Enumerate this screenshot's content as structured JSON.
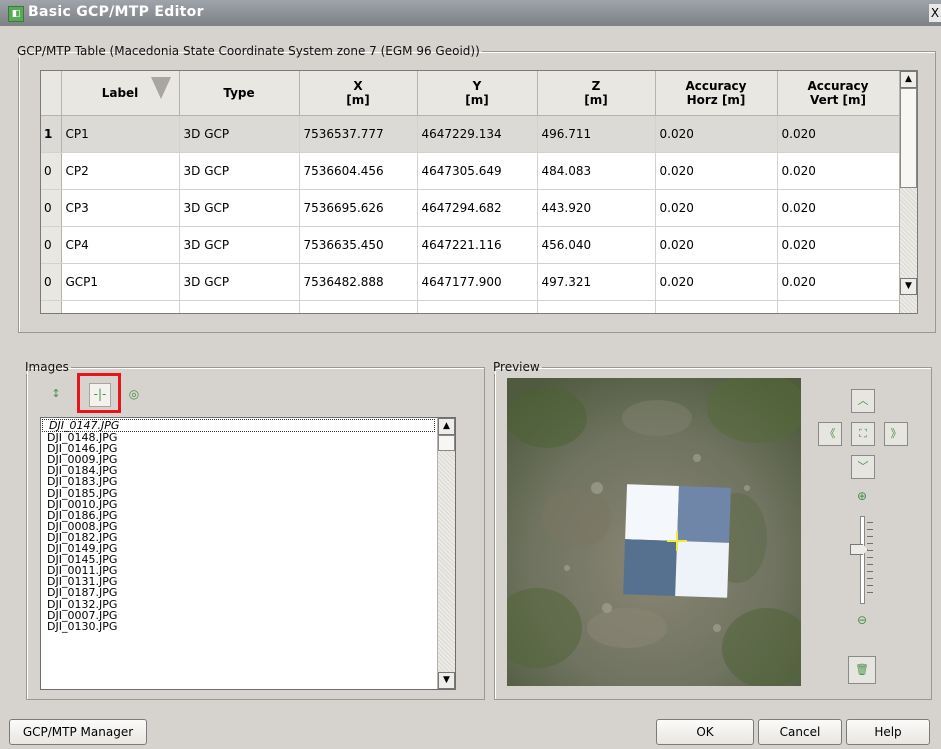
{
  "window": {
    "title": "Basic GCP/MTP Editor",
    "close_glyph": "X",
    "app_icon": "app-icon"
  },
  "table_group": {
    "legend": "GCP/MTP Table (Macedonia State Coordinate System zone 7 (EGM 96 Geoid))"
  },
  "table": {
    "headers": [
      {
        "line1": "Label",
        "line2": ""
      },
      {
        "line1": "Type",
        "line2": ""
      },
      {
        "line1": "X",
        "line2": "[m]"
      },
      {
        "line1": "Y",
        "line2": "[m]"
      },
      {
        "line1": "Z",
        "line2": "[m]"
      },
      {
        "line1": "Accuracy",
        "line2": "Horz [m]"
      },
      {
        "line1": "Accuracy",
        "line2": "Vert [m]"
      }
    ],
    "rows": [
      {
        "flag": "1",
        "label": "CP1",
        "type": "3D GCP",
        "x": "7536537.777",
        "y": "4647229.134",
        "z": "496.711",
        "acc_h": "0.020",
        "acc_v": "0.020"
      },
      {
        "flag": "0",
        "label": "CP2",
        "type": "3D GCP",
        "x": "7536604.456",
        "y": "4647305.649",
        "z": "484.083",
        "acc_h": "0.020",
        "acc_v": "0.020"
      },
      {
        "flag": "0",
        "label": "CP3",
        "type": "3D GCP",
        "x": "7536695.626",
        "y": "4647294.682",
        "z": "443.920",
        "acc_h": "0.020",
        "acc_v": "0.020"
      },
      {
        "flag": "0",
        "label": "CP4",
        "type": "3D GCP",
        "x": "7536635.450",
        "y": "4647221.116",
        "z": "456.040",
        "acc_h": "0.020",
        "acc_v": "0.020"
      },
      {
        "flag": "0",
        "label": "GCP1",
        "type": "3D GCP",
        "x": "7536482.888",
        "y": "4647177.900",
        "z": "497.321",
        "acc_h": "0.020",
        "acc_v": "0.020"
      }
    ]
  },
  "images_group": {
    "legend": "Images",
    "tools": [
      "sort-az-icon",
      "tie-point-icon",
      "camera-icon"
    ],
    "files": [
      "DJI_0147.JPG",
      "DJI_0148.JPG",
      "DJI_0146.JPG",
      "DJI_0009.JPG",
      "DJI_0184.JPG",
      "DJI_0183.JPG",
      "DJI_0185.JPG",
      "DJI_0010.JPG",
      "DJI_0186.JPG",
      "DJI_0008.JPG",
      "DJI_0182.JPG",
      "DJI_0149.JPG",
      "DJI_0145.JPG",
      "DJI_0011.JPG",
      "DJI_0131.JPG",
      "DJI_0187.JPG",
      "DJI_0132.JPG",
      "DJI_0007.JPG",
      "DJI_0130.JPG"
    ]
  },
  "preview_group": {
    "legend": "Preview",
    "nav": [
      "pan-up-icon",
      "pan-left-icon",
      "fit-icon",
      "pan-right-icon",
      "pan-down-icon"
    ],
    "zoom_in": "zoom-in-icon",
    "zoom_out": "zoom-out-icon",
    "delete": "trash-icon"
  },
  "footer": {
    "manager_button": "GCP/MTP Manager",
    "ok": "OK",
    "cancel": "Cancel",
    "help": "Help"
  },
  "colors": {
    "accent_icon": "#4a8f4a",
    "highlight": "#e8141c",
    "crosshair": "#f0ea3a",
    "window_bg": "#d6d3ce"
  }
}
